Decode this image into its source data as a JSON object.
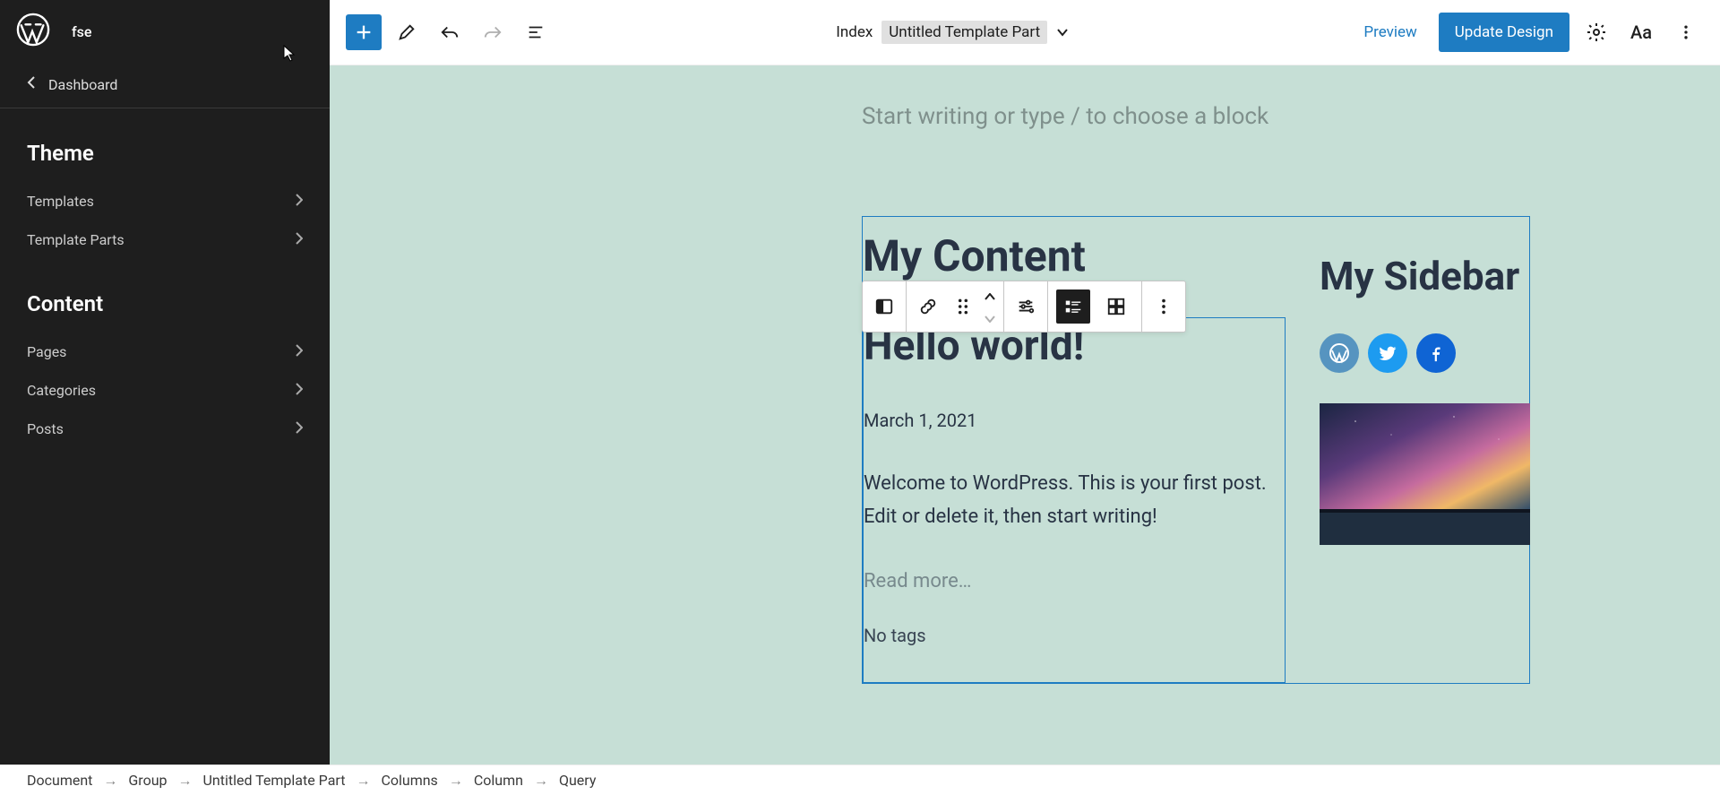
{
  "site": {
    "name": "fse"
  },
  "sidebar": {
    "back_label": "Dashboard",
    "section_theme": "Theme",
    "section_content": "Content",
    "theme_items": [
      {
        "label": "Templates"
      },
      {
        "label": "Template Parts"
      }
    ],
    "content_items": [
      {
        "label": "Pages"
      },
      {
        "label": "Categories"
      },
      {
        "label": "Posts"
      }
    ]
  },
  "topbar": {
    "context_label": "Index",
    "template_part_name": "Untitled Template Part",
    "preview_label": "Preview",
    "update_label": "Update Design"
  },
  "canvas": {
    "placeholder": "Start writing or type / to choose a block",
    "content_title": "My Content",
    "post": {
      "title": "Hello world!",
      "date": "March 1, 2021",
      "excerpt": "Welcome to WordPress. This is your first post. Edit or delete it, then start writing!",
      "read_more": "Read more…",
      "no_tags": "No tags"
    },
    "aside": {
      "title": "My Sidebar"
    }
  },
  "breadcrumb": [
    "Document",
    "Group",
    "Untitled Template Part",
    "Columns",
    "Column",
    "Query"
  ],
  "icons": {
    "add": "plus-icon",
    "edit": "pencil-icon",
    "undo": "undo-icon",
    "redo": "redo-icon",
    "outline": "list-icon",
    "settings": "gear-icon",
    "styles": "typography-icon",
    "more": "more-vertical-icon"
  }
}
